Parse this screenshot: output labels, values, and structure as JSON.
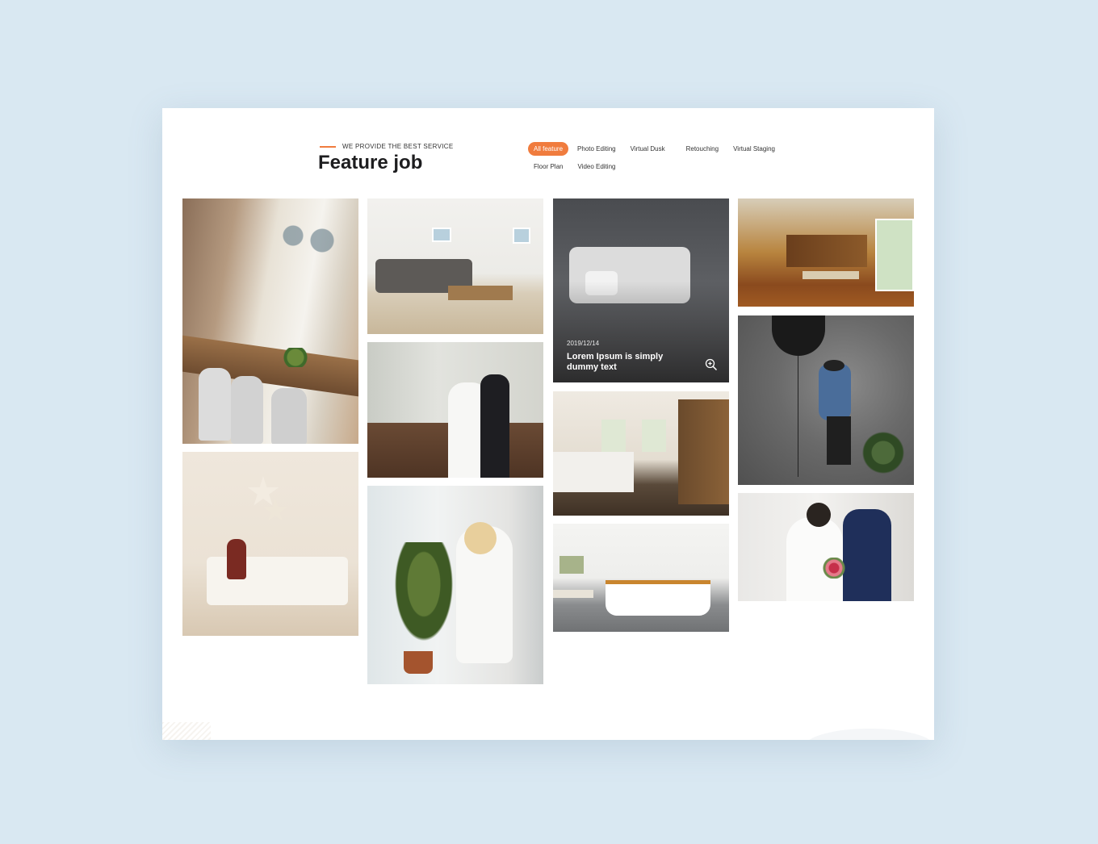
{
  "header": {
    "eyebrow": "WE PROVIDE THE BEST SERVICE",
    "title": "Feature job",
    "accent_color": "#f07c3e"
  },
  "filters": {
    "row1": [
      "All feature",
      "Photo Editing",
      "Virtual Dusk",
      "Retouching",
      "Virtual Staging"
    ],
    "row2": [
      "Floor Plan",
      "Video Editing"
    ],
    "active": "All feature"
  },
  "gallery": {
    "featured": {
      "date": "2019/12/14",
      "title": "Lorem Ipsum is simply dummy text",
      "icon": "zoom-in-icon"
    }
  }
}
